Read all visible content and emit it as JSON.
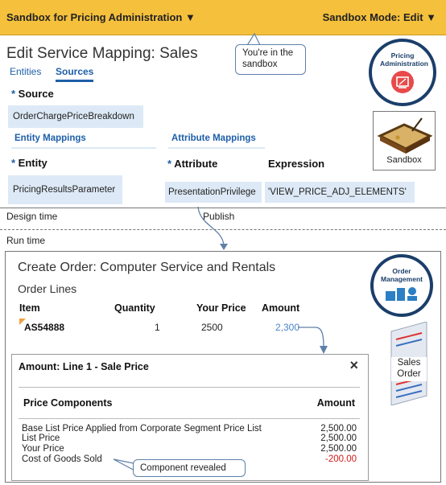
{
  "topbar": {
    "left": "Sandbox for Pricing Administration ▼",
    "right": "Sandbox Mode: Edit ▼"
  },
  "design": {
    "title": "Edit Service Mapping: Sales",
    "tabs": [
      "Entities",
      "Sources"
    ],
    "source_label": "Source",
    "source_value": "OrderChargePriceBreakdown",
    "entity_mappings": "Entity Mappings",
    "attribute_mappings": "Attribute Mappings",
    "entity_label": "Entity",
    "entity_value": "PricingResultsParameter",
    "attribute_label": "Attribute",
    "expression_label": "Expression",
    "attribute_value": "PresentationPrivilege",
    "expression_value": "'VIEW_PRICE_ADJ_ELEMENTS'",
    "callout": "You're in the sandbox",
    "badge": "Pricing Administration",
    "sandbox_label": "Sandbox"
  },
  "labels": {
    "design_time": "Design time",
    "publish": "Publish",
    "run_time": "Run time"
  },
  "run": {
    "title": "Create Order: Computer Service and Rentals",
    "order_lines": "Order Lines",
    "cols": [
      "Item",
      "Quantity",
      "Your Price",
      "Amount"
    ],
    "row": {
      "item": "AS54888",
      "qty": "1",
      "price": "2500",
      "amount": "2,300"
    },
    "badge": "Order Management",
    "sales_order": "Sales Order"
  },
  "popup": {
    "title": "Amount: Line 1 - Sale Price",
    "close": "×",
    "col1": "Price Components",
    "col2": "Amount",
    "rows": [
      {
        "name": "Base List Price Applied from Corporate  Segment Price List",
        "amount": "2,500.00"
      },
      {
        "name": "List Price",
        "amount": "2,500.00"
      },
      {
        "name": "Your Price",
        "amount": "2,500.00"
      },
      {
        "name": "Cost of Goods Sold",
        "amount": "-200.00"
      }
    ],
    "callout": "Component revealed"
  },
  "colors": {
    "accent": "#1d5fa8",
    "banner": "#f5c03c",
    "negative": "#d11a1a"
  }
}
